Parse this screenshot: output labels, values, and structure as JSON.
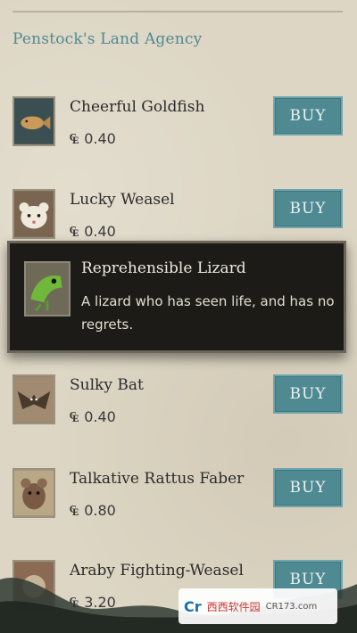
{
  "header": {
    "title": "Penstock's Land Agency"
  },
  "currency_symbol": "₠",
  "buy_label": "BUY",
  "items": [
    {
      "name": "Cheerful Goldfish",
      "price": "0.40",
      "icon": "goldfish-icon"
    },
    {
      "name": "Lucky Weasel",
      "price": "0.40",
      "icon": "weasel-icon"
    },
    {
      "name": "Sulky Bat",
      "price": "0.40",
      "icon": "bat-icon"
    },
    {
      "name": "Talkative Rattus Faber",
      "price": "0.80",
      "icon": "rat-icon"
    },
    {
      "name": "Araby Fighting-Weasel",
      "price": "3.20",
      "icon": "fighting-weasel-icon"
    }
  ],
  "tooltip": {
    "title": "Reprehensible Lizard",
    "description": "A lizard who has seen life, and has no regrets.",
    "icon": "lizard-icon"
  },
  "watermark": {
    "logo": "Cr",
    "text": "西西软件园",
    "url": "CR173.com"
  },
  "colors": {
    "accent": "#4f8a93",
    "background": "#ddd6c4",
    "tooltip_bg": "#1c1b18"
  }
}
